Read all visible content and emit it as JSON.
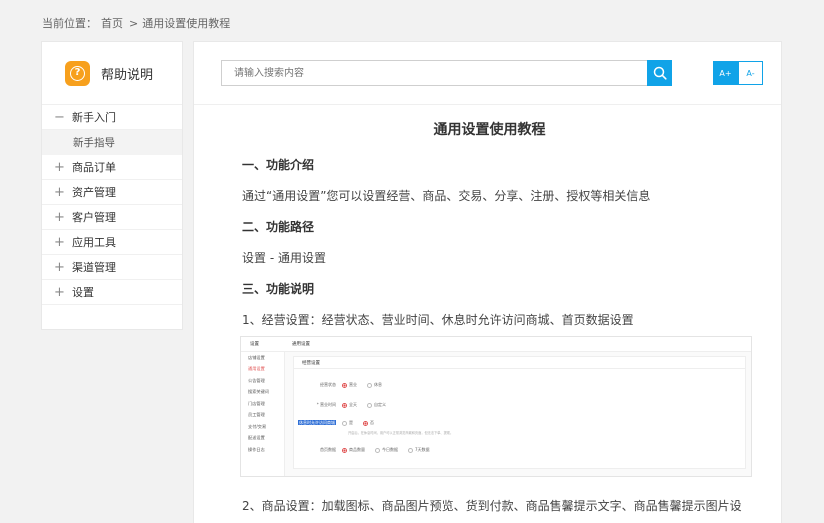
{
  "breadcrumb": {
    "prefix": "当前位置：",
    "home": "首页",
    "separator": ">",
    "current": "通用设置使用教程"
  },
  "sidebar": {
    "title": "帮助说明",
    "items": [
      {
        "sign": "−",
        "label": "新手入门",
        "expanded": true
      },
      {
        "sub": "新手指导"
      },
      {
        "sign": "+",
        "label": "商品订单"
      },
      {
        "sign": "+",
        "label": "资产管理"
      },
      {
        "sign": "+",
        "label": "客户管理"
      },
      {
        "sign": "+",
        "label": "应用工具"
      },
      {
        "sign": "+",
        "label": "渠道管理"
      },
      {
        "sign": "+",
        "label": "设置"
      }
    ]
  },
  "search": {
    "placeholder": "请输入搜索内容"
  },
  "font_buttons": {
    "larger": "A+",
    "smaller": "A-"
  },
  "colors": {
    "accent": "#10a3e8",
    "help_icon": "#f7a01d"
  },
  "article": {
    "title": "通用设置使用教程",
    "s1_heading": "一、功能介绍",
    "s1_text": "通过“通用设置”您可以设置经营、商品、交易、分享、注册、授权等相关信息",
    "s2_heading": "二、功能路径",
    "s2_text": "设置 - 通用设置",
    "s3_heading": "三、功能说明",
    "item1": "1、经营设置：经营状态、营业时间、休息时允许访问商城、首页数据设置",
    "item2": "2、商品设置：加载图标、商品图片预览、货到付款、商品售馨提示文字、商品售馨提示图片设"
  },
  "screenshot": {
    "head_left": "设置",
    "head_right": "通用设置",
    "menu": [
      "店铺设置",
      "通用设置",
      "公告管理",
      "搜索关键词",
      "门店管理",
      "员工管理",
      "支付/交易",
      "配送设置",
      "操作日志"
    ],
    "panel_title": "经营设置",
    "rows": [
      {
        "label": "经营状态",
        "options": [
          "营业",
          "休息"
        ]
      },
      {
        "label": "* 营业时间",
        "options": [
          "全天",
          "自定义"
        ]
      },
      {
        "label": "休息时允许访问商城",
        "options": [
          "是",
          "否"
        ]
      },
      {
        "label": "首页数据",
        "options": [
          "商品数量",
          "今日数据",
          "7天数据"
        ]
      }
    ],
    "note": "开启后，在休息时间，用户可以正常浏览商城和页面，但无法下单、提现。"
  }
}
